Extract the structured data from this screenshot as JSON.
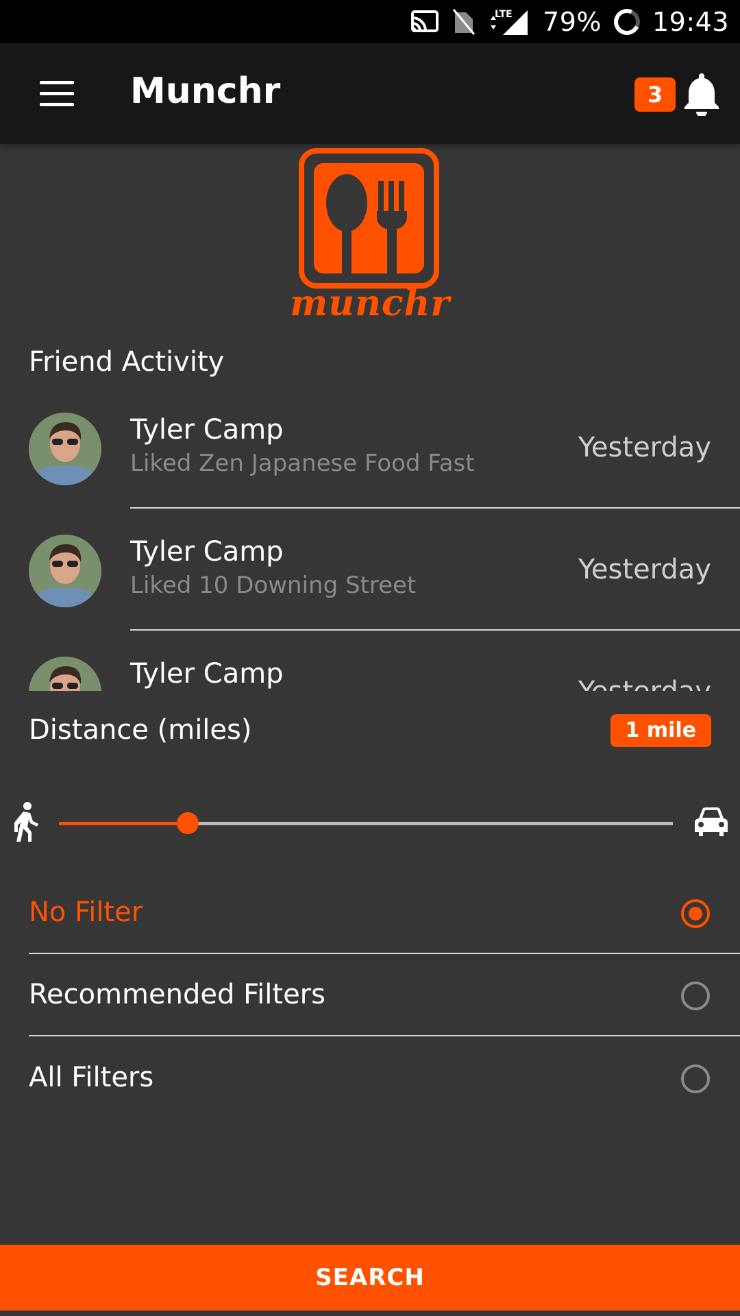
{
  "status_bar": {
    "network": "LTE",
    "battery": "79%",
    "time": "19:43"
  },
  "app_bar": {
    "title": "Munchr",
    "notification_count": "3"
  },
  "logo": {
    "wordmark": "munchr"
  },
  "friend_activity": {
    "title": "Friend Activity",
    "items": [
      {
        "name": "Tyler Camp",
        "action": "Liked Zen Japanese Food Fast",
        "time": "Yesterday"
      },
      {
        "name": "Tyler Camp",
        "action": "Liked 10 Downing Street",
        "time": "Yesterday"
      },
      {
        "name": "Tyler Camp",
        "action": "",
        "time": "Yesterday"
      }
    ]
  },
  "distance": {
    "label": "Distance (miles)",
    "badge": "1 mile",
    "slider_fraction": 0.21,
    "left_icon": "walk-icon",
    "right_icon": "car-icon"
  },
  "filters": {
    "options": [
      {
        "label": "No Filter",
        "selected": true
      },
      {
        "label": "Recommended Filters",
        "selected": false
      },
      {
        "label": "All Filters",
        "selected": false
      }
    ]
  },
  "search": {
    "label": "SEARCH"
  },
  "colors": {
    "accent": "#ff5100",
    "background": "#363636",
    "app_bar": "#171717"
  }
}
